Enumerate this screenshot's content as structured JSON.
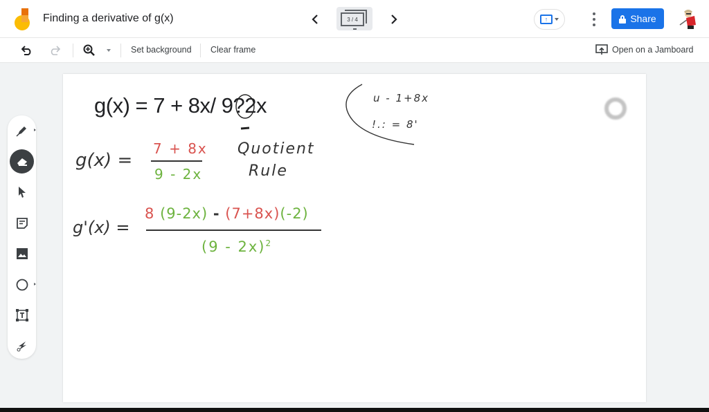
{
  "header": {
    "title": "Finding a derivative of g(x)",
    "frame_indicator": "3 / 4",
    "prev_icon": "chevron-left-icon",
    "next_icon": "chevron-right-icon",
    "share_label": "Share"
  },
  "toolbar": {
    "set_background": "Set background",
    "clear_frame": "Clear frame",
    "open_on_jamboard": "Open on a Jamboard"
  },
  "sidebar": {
    "tools": [
      {
        "name": "pen",
        "icon": "pen-icon"
      },
      {
        "name": "eraser",
        "icon": "eraser-icon",
        "active": true
      },
      {
        "name": "select",
        "icon": "cursor-icon"
      },
      {
        "name": "sticky-note",
        "icon": "sticky-note-icon"
      },
      {
        "name": "image",
        "icon": "image-icon"
      },
      {
        "name": "shape",
        "icon": "circle-icon"
      },
      {
        "name": "text-box",
        "icon": "text-box-icon"
      },
      {
        "name": "laser",
        "icon": "laser-icon"
      }
    ]
  },
  "canvas": {
    "typed_equation": "g(x) = 7 + 8x/ 9?2x",
    "handwriting": {
      "line1_lhs": "g(x) =",
      "line1_numerator": "7 + 8x",
      "line1_denominator": "9 - 2x",
      "note_line1": "Quotient",
      "note_line2": "Rule",
      "line2_lhs": "g'(x) =",
      "line2_num_part1": "8",
      "line2_num_part2": "(9-2x)",
      "line2_num_part3": "-",
      "line2_num_part4": "(7+8x)",
      "line2_num_part5": "(-2)",
      "line2_denominator": "(9 - 2x)",
      "line2_exponent": "2",
      "aside_line1": "u - 1+8x",
      "aside_line2": "!.: = 8'",
      "minus_mark": "-"
    },
    "colors": {
      "red": "#d9534f",
      "green": "#6db33f",
      "ink": "#333333"
    }
  }
}
